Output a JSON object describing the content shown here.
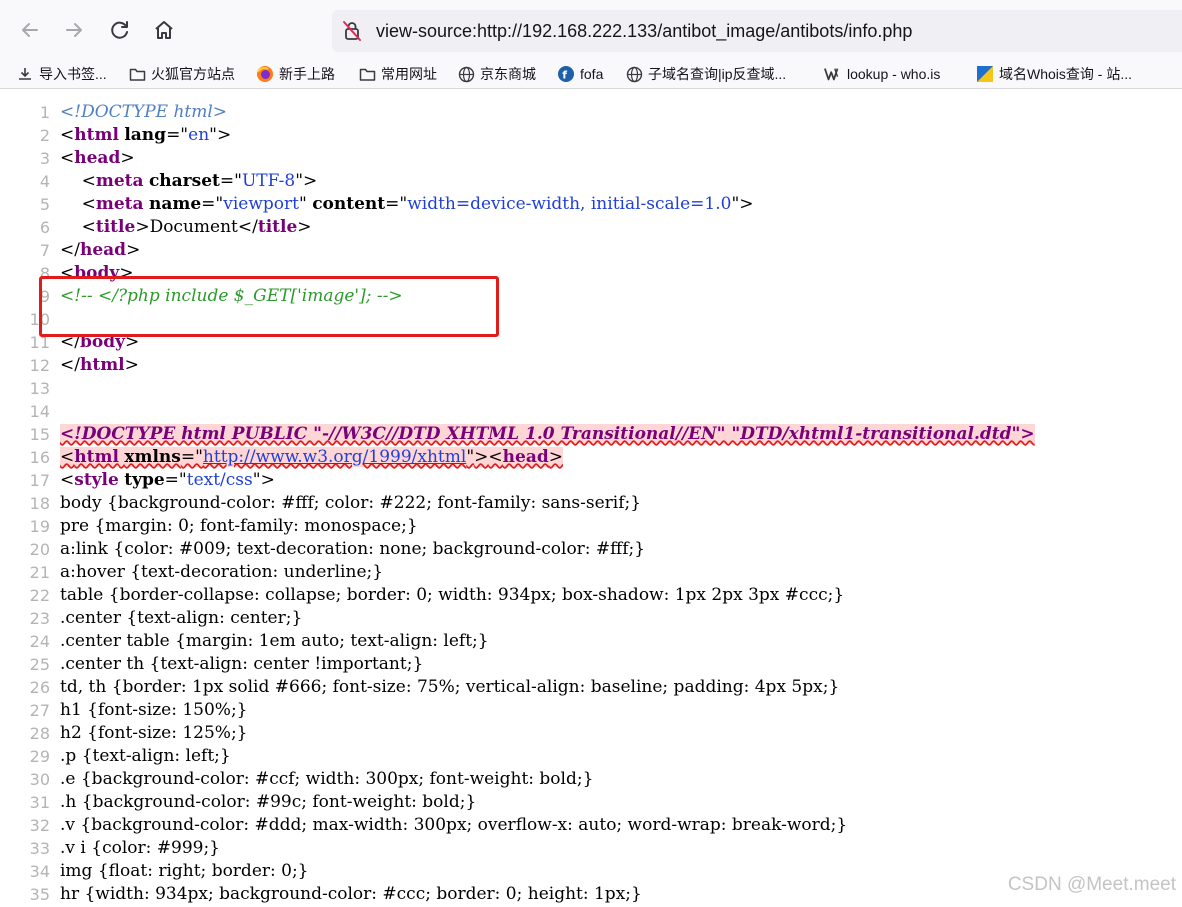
{
  "browser": {
    "url": "view-source:http://192.168.222.133/antibot_image/antibots/info.php",
    "bookmarks": [
      {
        "label": "导入书签...",
        "icon": "import-icon"
      },
      {
        "label": "火狐官方站点",
        "icon": "folder-icon"
      },
      {
        "label": "新手上路",
        "icon": "firefox-icon"
      },
      {
        "label": "常用网址",
        "icon": "folder-icon"
      },
      {
        "label": "京东商城",
        "icon": "globe-icon"
      },
      {
        "label": "fofa",
        "icon": "fofa-icon"
      },
      {
        "label": "子域名查询|ip反查域...",
        "icon": "globe-icon"
      },
      {
        "label": "lookup - who.is",
        "icon": "whois-icon"
      },
      {
        "label": "域名Whois查询 - 站...",
        "icon": "chinaz-icon"
      }
    ]
  },
  "source_lines": [
    "<!DOCTYPE html>",
    "<html lang=\"en\">",
    "<head>",
    "    <meta charset=\"UTF-8\">",
    "    <meta name=\"viewport\" content=\"width=device-width, initial-scale=1.0\">",
    "    <title>Document</title>",
    "</head>",
    "<body>",
    "<!-- </?php include $_GET['image']; -->",
    "",
    "</body>",
    "</html>",
    "",
    "",
    "<!DOCTYPE html PUBLIC \"-//W3C//DTD XHTML 1.0 Transitional//EN\" \"DTD/xhtml1-transitional.dtd\">",
    "<html xmlns=\"http://www.w3.org/1999/xhtml\"><head>",
    "<style type=\"text/css\">",
    "body {background-color: #fff; color: #222; font-family: sans-serif;}",
    "pre {margin: 0; font-family: monospace;}",
    "a:link {color: #009; text-decoration: none; background-color: #fff;}",
    "a:hover {text-decoration: underline;}",
    "table {border-collapse: collapse; border: 0; width: 934px; box-shadow: 1px 2px 3px #ccc;}",
    ".center {text-align: center;}",
    ".center table {margin: 1em auto; text-align: left;}",
    ".center th {text-align: center !important;}",
    "td, th {border: 1px solid #666; font-size: 75%; vertical-align: baseline; padding: 4px 5px;}",
    "h1 {font-size: 150%;}",
    "h2 {font-size: 125%;}",
    ".p {text-align: left;}",
    ".e {background-color: #ccf; width: 300px; font-weight: bold;}",
    ".h {background-color: #99c; font-weight: bold;}",
    ".v {background-color: #ddd; max-width: 300px; overflow-x: auto; word-wrap: break-word;}",
    ".v i {color: #999;}",
    "img {float: right; border: 0;}",
    "hr {width: 934px; background-color: #ccc; border: 0; height: 1px;}"
  ],
  "watermark": "CSDN @Meet.meet",
  "colors": {
    "highlight_box": "#e11b1b",
    "tag": "#7a007a",
    "attr_value": "#1f3fd6",
    "comment": "#2b9a2b"
  }
}
